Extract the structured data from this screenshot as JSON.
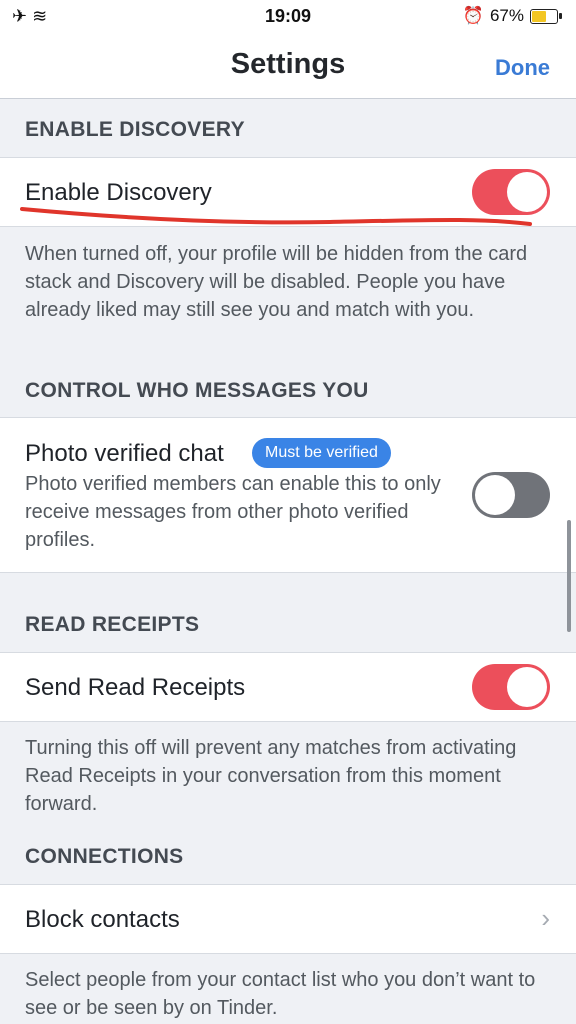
{
  "status_bar": {
    "time": "19:09",
    "left_icons": "✈ ≋",
    "battery_text": "67%",
    "battery_level": 0.67,
    "alarm_icon": "⏰"
  },
  "nav": {
    "title": "Settings",
    "done_label": "Done"
  },
  "sections": {
    "discovery": {
      "header": "ENABLE DISCOVERY",
      "row_label": "Enable Discovery",
      "toggle_on": true,
      "description": "When turned off, your profile will be hidden from the card stack and Discovery will be disabled. People you have already liked may still see you and match with you."
    },
    "messages": {
      "header": "CONTROL WHO MESSAGES YOU",
      "row_label": "Photo verified chat",
      "badge": "Must be verified",
      "row_sub": "Photo verified members can enable this to only receive messages from other photo verified profiles.",
      "toggle_on": false
    },
    "receipts": {
      "header": "READ RECEIPTS",
      "row_label": "Send Read Receipts",
      "toggle_on": true,
      "description": "Turning this off will prevent any matches from activating Read Receipts in your conversation from this moment forward."
    },
    "connections": {
      "header": "CONNECTIONS",
      "row_label": "Block contacts",
      "description": "Select people from your contact list who you don’t want to see or be seen by on Tinder."
    }
  },
  "colors": {
    "toggle_on": "#ec4f5b",
    "toggle_off": "#707379",
    "accent": "#3a7bd5",
    "annotation": "#e0352b"
  }
}
